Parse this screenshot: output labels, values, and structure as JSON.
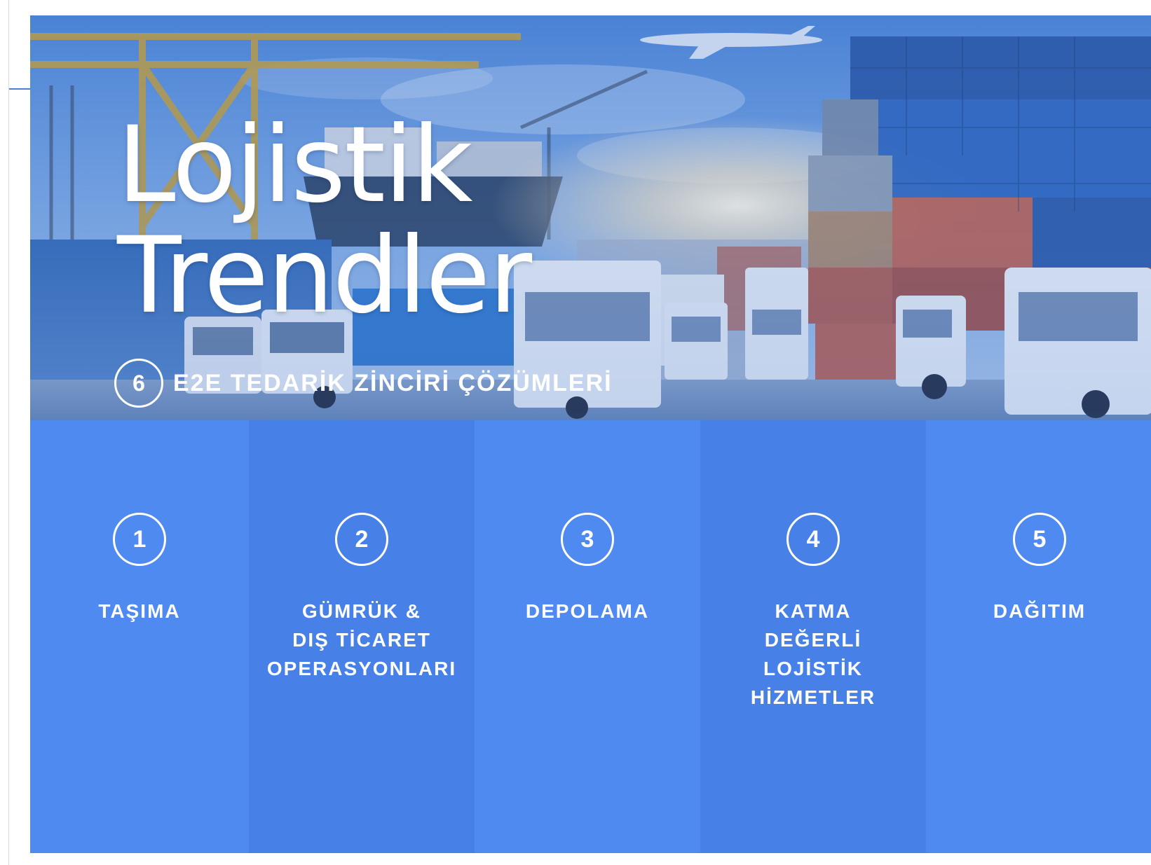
{
  "hero": {
    "title_line1": "Lojistik",
    "title_line2": "Trendler",
    "subtitle_number": "6",
    "subtitle": "E2E TEDARİK ZİNCİRİ ÇÖZÜMLERİ"
  },
  "steps": [
    {
      "number": "1",
      "label": "TAŞIMA"
    },
    {
      "number": "2",
      "label": "GÜMRÜK &\nDIŞ TİCARET\nOPERASYONLARI"
    },
    {
      "number": "3",
      "label": "DEPOLAMA"
    },
    {
      "number": "4",
      "label": "KATMA\nDEĞERLİ\nLOJİSTİK\nHİZMETLER"
    },
    {
      "number": "5",
      "label": "DAĞITIM"
    }
  ],
  "colors": {
    "primary_blue": "#4e8af0",
    "alternate_blue": "#4780e6",
    "text": "#ffffff"
  }
}
